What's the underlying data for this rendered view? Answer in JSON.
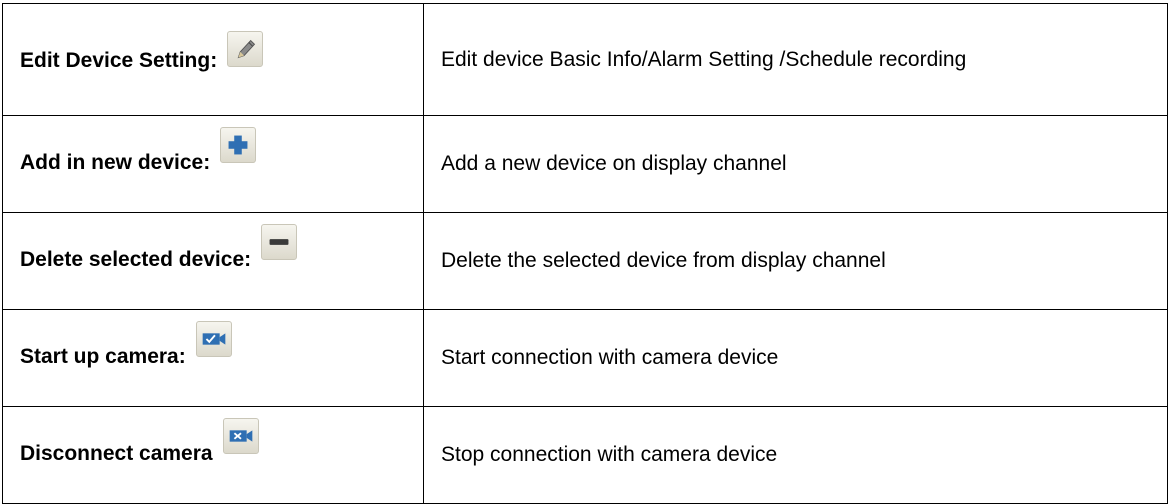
{
  "rows": [
    {
      "label": "Edit Device Setting:",
      "icon": "pencil-icon",
      "description": "Edit device Basic Info/Alarm Setting /Schedule recording"
    },
    {
      "label": "Add in new device:",
      "icon": "plus-icon",
      "description": "Add a new device on display channel"
    },
    {
      "label": "Delete selected device:",
      "icon": "minus-icon",
      "description": "Delete the selected device from display channel"
    },
    {
      "label": "Start up camera:",
      "icon": "camera-check-icon",
      "description": "Start connection with camera device"
    },
    {
      "label": "Disconnect camera",
      "icon": "camera-x-icon",
      "description": "Stop connection with camera device"
    }
  ],
  "colors": {
    "icon_blue": "#2f6fb3",
    "icon_face": "#e8e6dd",
    "border": "#000000"
  }
}
